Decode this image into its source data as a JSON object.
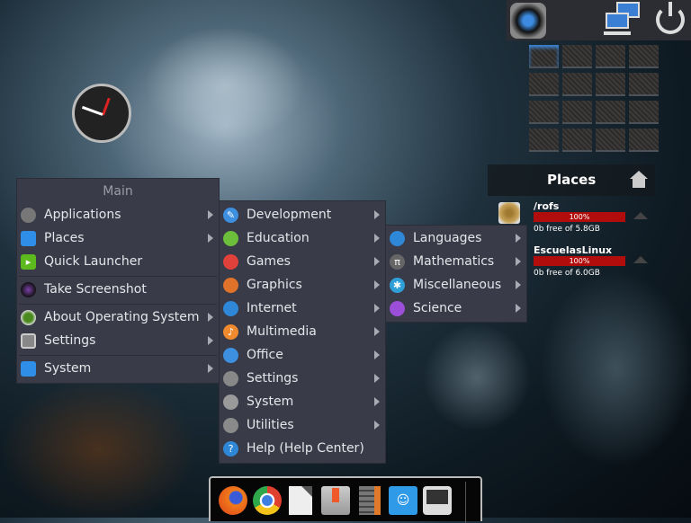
{
  "main_menu": {
    "title": "Main",
    "items": [
      {
        "label": "Applications",
        "icon": "gear-icon",
        "submenu": true
      },
      {
        "label": "Places",
        "icon": "folder-icon",
        "submenu": true
      },
      {
        "label": "Quick Launcher",
        "icon": "launcher-icon",
        "submenu": false
      },
      {
        "label": "Take Screenshot",
        "icon": "camera-icon",
        "submenu": false
      },
      {
        "label": "About Operating System",
        "icon": "os-logo-icon",
        "submenu": true
      },
      {
        "label": "Settings",
        "icon": "settings-icon",
        "submenu": true
      },
      {
        "label": "System",
        "icon": "system-icon",
        "submenu": true
      }
    ]
  },
  "applications_menu": {
    "items": [
      {
        "label": "Development",
        "icon": "wrench-icon",
        "color": "#3d8fe0",
        "submenu": true
      },
      {
        "label": "Education",
        "icon": "education-icon",
        "color": "#6cbf3a",
        "submenu": true
      },
      {
        "label": "Games",
        "icon": "games-icon",
        "color": "#e0413a",
        "submenu": true
      },
      {
        "label": "Graphics",
        "icon": "graphics-icon",
        "color": "#e0722a",
        "submenu": true
      },
      {
        "label": "Internet",
        "icon": "globe-icon",
        "color": "#2f87d8",
        "submenu": true
      },
      {
        "label": "Multimedia",
        "icon": "music-icon",
        "color": "#f08a2e",
        "submenu": true
      },
      {
        "label": "Office",
        "icon": "office-icon",
        "color": "#3d8fe0",
        "submenu": true
      },
      {
        "label": "Settings",
        "icon": "settings-icon",
        "color": "#888888",
        "submenu": true
      },
      {
        "label": "System",
        "icon": "system-gear-icon",
        "color": "#9a9a9a",
        "submenu": true
      },
      {
        "label": "Utilities",
        "icon": "tools-icon",
        "color": "#8a8a8a",
        "submenu": true
      },
      {
        "label": "Help (Help Center)",
        "icon": "help-icon",
        "color": "#2f87d8",
        "submenu": false
      }
    ]
  },
  "education_menu": {
    "items": [
      {
        "label": "Languages",
        "icon": "languages-icon",
        "color": "#2f87d8"
      },
      {
        "label": "Mathematics",
        "icon": "pi-icon",
        "color": "#666666"
      },
      {
        "label": "Miscellaneous",
        "icon": "misc-icon",
        "color": "#2f9fd8"
      },
      {
        "label": "Science",
        "icon": "science-icon",
        "color": "#9b4fd8"
      }
    ]
  },
  "places_widget": {
    "title": "Places",
    "drives": [
      {
        "name": "/rofs",
        "percent": 100,
        "percent_label": "100%",
        "free": "0b free of 5.8GB"
      },
      {
        "name": "EscuelasLinux",
        "percent": 100,
        "percent_label": "100%",
        "free": "0b free of 6.0GB"
      }
    ]
  },
  "dock": {
    "apps": [
      "firefox-icon",
      "chrome-icon",
      "document-icon",
      "install-icon",
      "calculator-icon",
      "files-icon",
      "terminal-icon"
    ]
  }
}
